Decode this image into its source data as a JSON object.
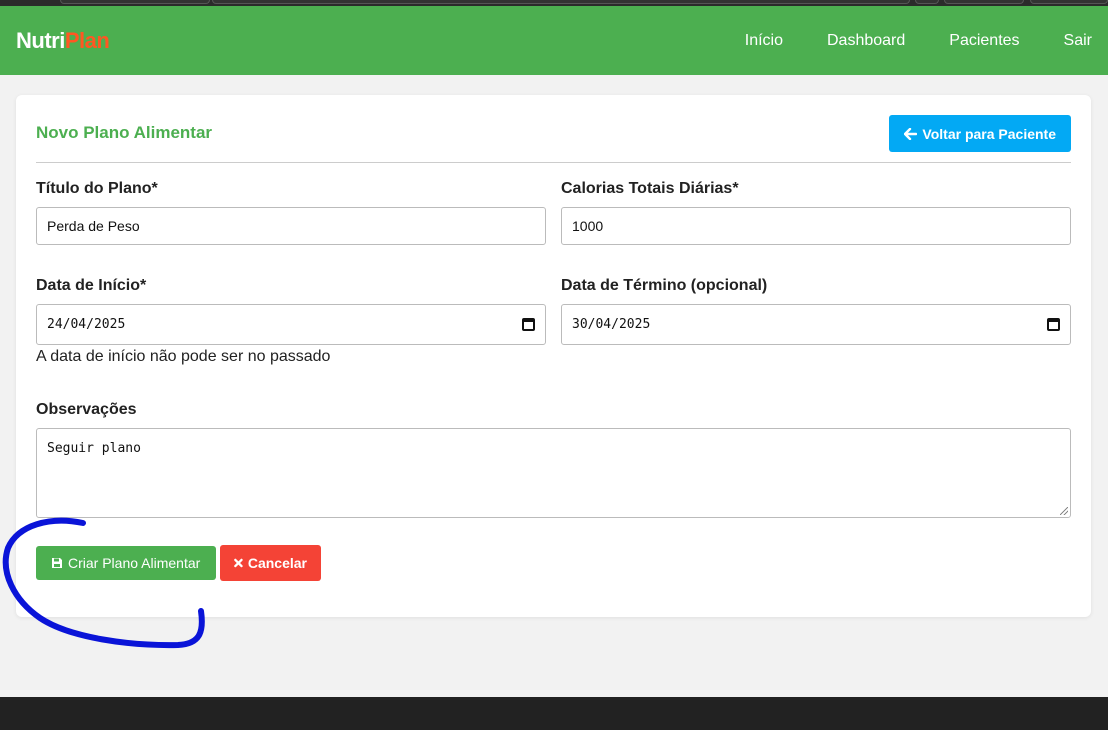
{
  "brand": {
    "part1": "Nutri",
    "part2": "Plan"
  },
  "nav": {
    "items": [
      "Início",
      "Dashboard",
      "Pacientes",
      "Sair"
    ]
  },
  "page": {
    "title": "Novo Plano Alimentar",
    "back_label": "Voltar para Paciente"
  },
  "form": {
    "title_label": "Título do Plano*",
    "title_value": "Perda de Peso",
    "calories_label": "Calorias Totais Diárias*",
    "calories_value": "1000",
    "start_label": "Data de Início*",
    "start_value": "24/04/2025",
    "end_label": "Data de Término (opcional)",
    "end_value": "30/04/2025",
    "start_hint": "A data de início não pode ser no passado",
    "notes_label": "Observações",
    "notes_value": "Seguir plano",
    "submit_label": "Criar Plano Alimentar",
    "cancel_label": "Cancelar"
  },
  "colors": {
    "primary": "#4caf50",
    "accent": "#ff5722",
    "info": "#03a9f4",
    "danger": "#f44336",
    "annotation": "#0a14d8"
  },
  "icons": {
    "back": "arrow-left-icon",
    "save": "floppy-disk-icon",
    "cancel": "times-icon",
    "calendar": "calendar-icon"
  }
}
